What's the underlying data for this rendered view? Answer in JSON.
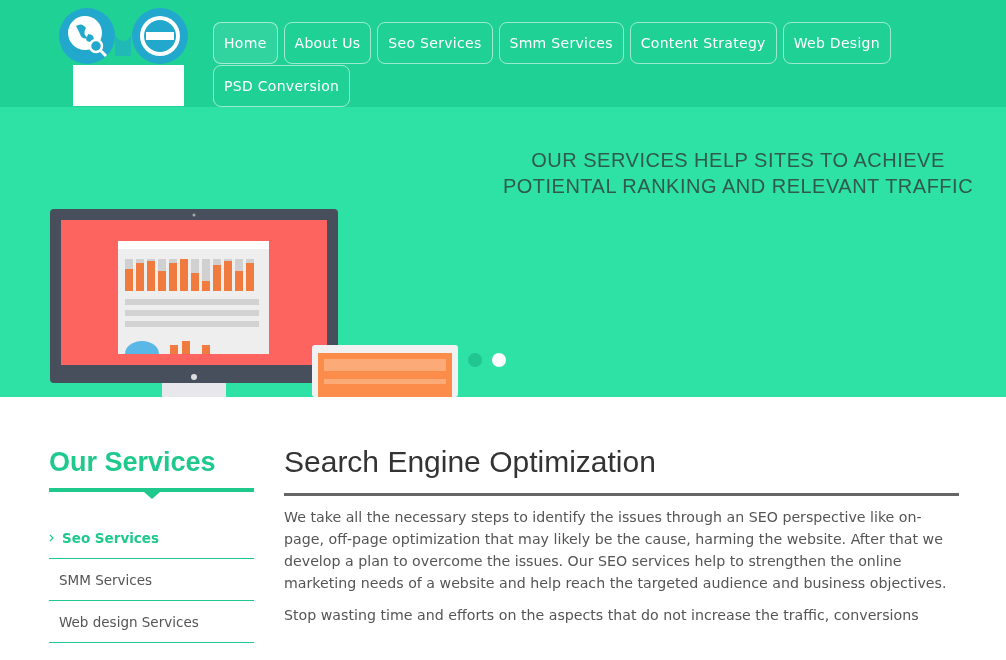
{
  "nav": [
    {
      "label": "Home",
      "selected": true
    },
    {
      "label": "About Us",
      "selected": false
    },
    {
      "label": "Seo Services",
      "selected": false
    },
    {
      "label": "Smm Services",
      "selected": false
    },
    {
      "label": "Content Strategy",
      "selected": false
    },
    {
      "label": "Web Design",
      "selected": false
    },
    {
      "label": "PSD Conversion",
      "selected": false
    }
  ],
  "hero": {
    "headline_lines": [
      "OUR SERVICES HELP SITES TO ACHIEVE",
      "POTIENTAL RANKING AND RELEVANT TRAFFIC"
    ],
    "slider_dots": [
      {
        "selected": false
      },
      {
        "selected": true
      }
    ]
  },
  "sidebar": {
    "title": "Our Services",
    "items": [
      {
        "label": "Seo Services",
        "selected": true
      },
      {
        "label": "SMM Services",
        "selected": false
      },
      {
        "label": "Web design Services",
        "selected": false
      }
    ]
  },
  "article": {
    "title": "Search Engine Optimization",
    "paragraphs": [
      "We take all the necessary steps to identify the issues through an SEO perspective like on-page, off-page optimization that may likely be the cause, harming the website. After that we develop a plan to overcome the issues. Our SEO services help to strengthen the online marketing needs of a website and help reach the targeted audience and business objectives.",
      "Stop wasting time and efforts on the aspects that do not increase the traffic, conversions"
    ]
  }
}
